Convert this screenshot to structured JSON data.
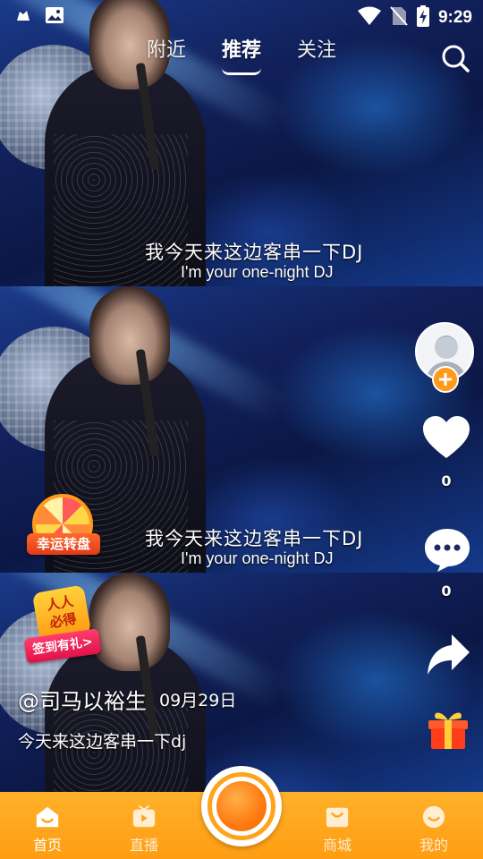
{
  "statusbar": {
    "time": "9:29",
    "left_icons": [
      "android-icon",
      "image-icon"
    ],
    "right_icons": [
      "wifi-icon",
      "no-sim-icon",
      "battery-charging-icon"
    ]
  },
  "tabs": [
    {
      "label": "附近",
      "active": false
    },
    {
      "label": "推荐",
      "active": true
    },
    {
      "label": "关注",
      "active": false
    }
  ],
  "video": {
    "subtitles": [
      {
        "zh": "我今天来这边客串一下DJ",
        "en": "I'm your one-night DJ"
      },
      {
        "zh": "我今天来这边客串一下DJ",
        "en": "I'm your one-night DJ"
      }
    ]
  },
  "rail": {
    "like_count": "0",
    "comment_count": "0"
  },
  "promos": {
    "wheel_label": "幸运转盘",
    "checkin_top": "人人\n必得",
    "checkin_label": "签到有礼>"
  },
  "post": {
    "author": "@司马以裕生",
    "date": "09月29日",
    "description": "今天来这边客串一下dj"
  },
  "nav": [
    {
      "label": "首页",
      "icon": "home-icon",
      "active": true
    },
    {
      "label": "直播",
      "icon": "tv-icon",
      "active": false
    },
    {
      "label": "商城",
      "icon": "shop-icon",
      "active": false
    },
    {
      "label": "我的",
      "icon": "smile-icon",
      "active": false
    }
  ],
  "colors": {
    "accent": "#ff9d12",
    "follow": "#ff9a1a"
  }
}
